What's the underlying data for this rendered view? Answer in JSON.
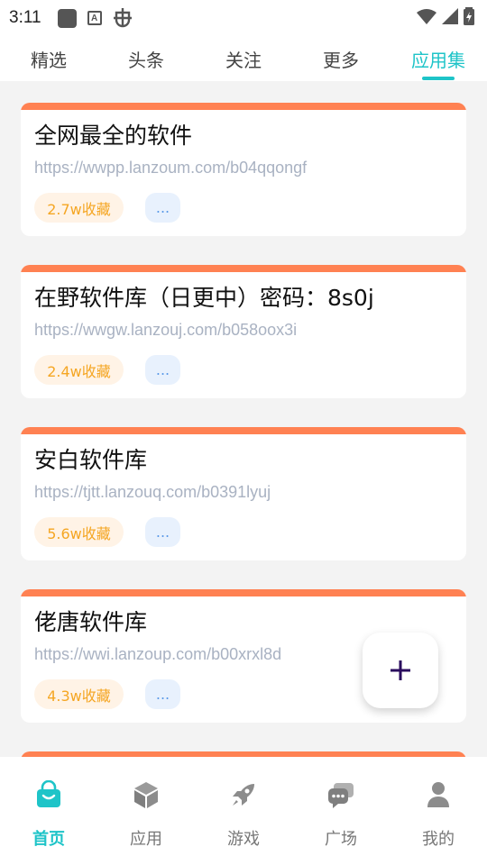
{
  "status_bar": {
    "time": "3:11"
  },
  "top_tabs": [
    {
      "label": "精选",
      "active": false
    },
    {
      "label": "头条",
      "active": false
    },
    {
      "label": "关注",
      "active": false
    },
    {
      "label": "更多",
      "active": false
    },
    {
      "label": "应用集",
      "active": true
    }
  ],
  "cards": [
    {
      "title": "全网最全的软件",
      "url": "https://wwpp.lanzoum.com/b04qqongf",
      "favorites": "2.7w收藏",
      "more": "..."
    },
    {
      "title": "在野软件库（日更中）密码：8s0j",
      "url": "https://wwgw.lanzouj.com/b058oox3i",
      "favorites": "2.4w收藏",
      "more": "..."
    },
    {
      "title": "安白软件库",
      "url": "https://tjtt.lanzouq.com/b0391lyuj",
      "favorites": "5.6w收藏",
      "more": "..."
    },
    {
      "title": "佬唐软件库",
      "url": "https://wwi.lanzoup.com/b00xrxl8d",
      "favorites": "4.3w收藏",
      "more": "..."
    }
  ],
  "bottom_nav": [
    {
      "label": "首页",
      "icon": "bag-icon",
      "active": true
    },
    {
      "label": "应用",
      "icon": "cube-icon",
      "active": false
    },
    {
      "label": "游戏",
      "icon": "rocket-icon",
      "active": false
    },
    {
      "label": "广场",
      "icon": "chat-icon",
      "active": false
    },
    {
      "label": "我的",
      "icon": "person-icon",
      "active": false
    }
  ],
  "colors": {
    "accent": "#1ec4c8",
    "card_top_bar": "#ff8152",
    "favorite_text": "#f5a623",
    "favorite_bg": "#fff3e6",
    "more_bg": "#e8f1fd",
    "url_text": "#a9b2c2"
  }
}
